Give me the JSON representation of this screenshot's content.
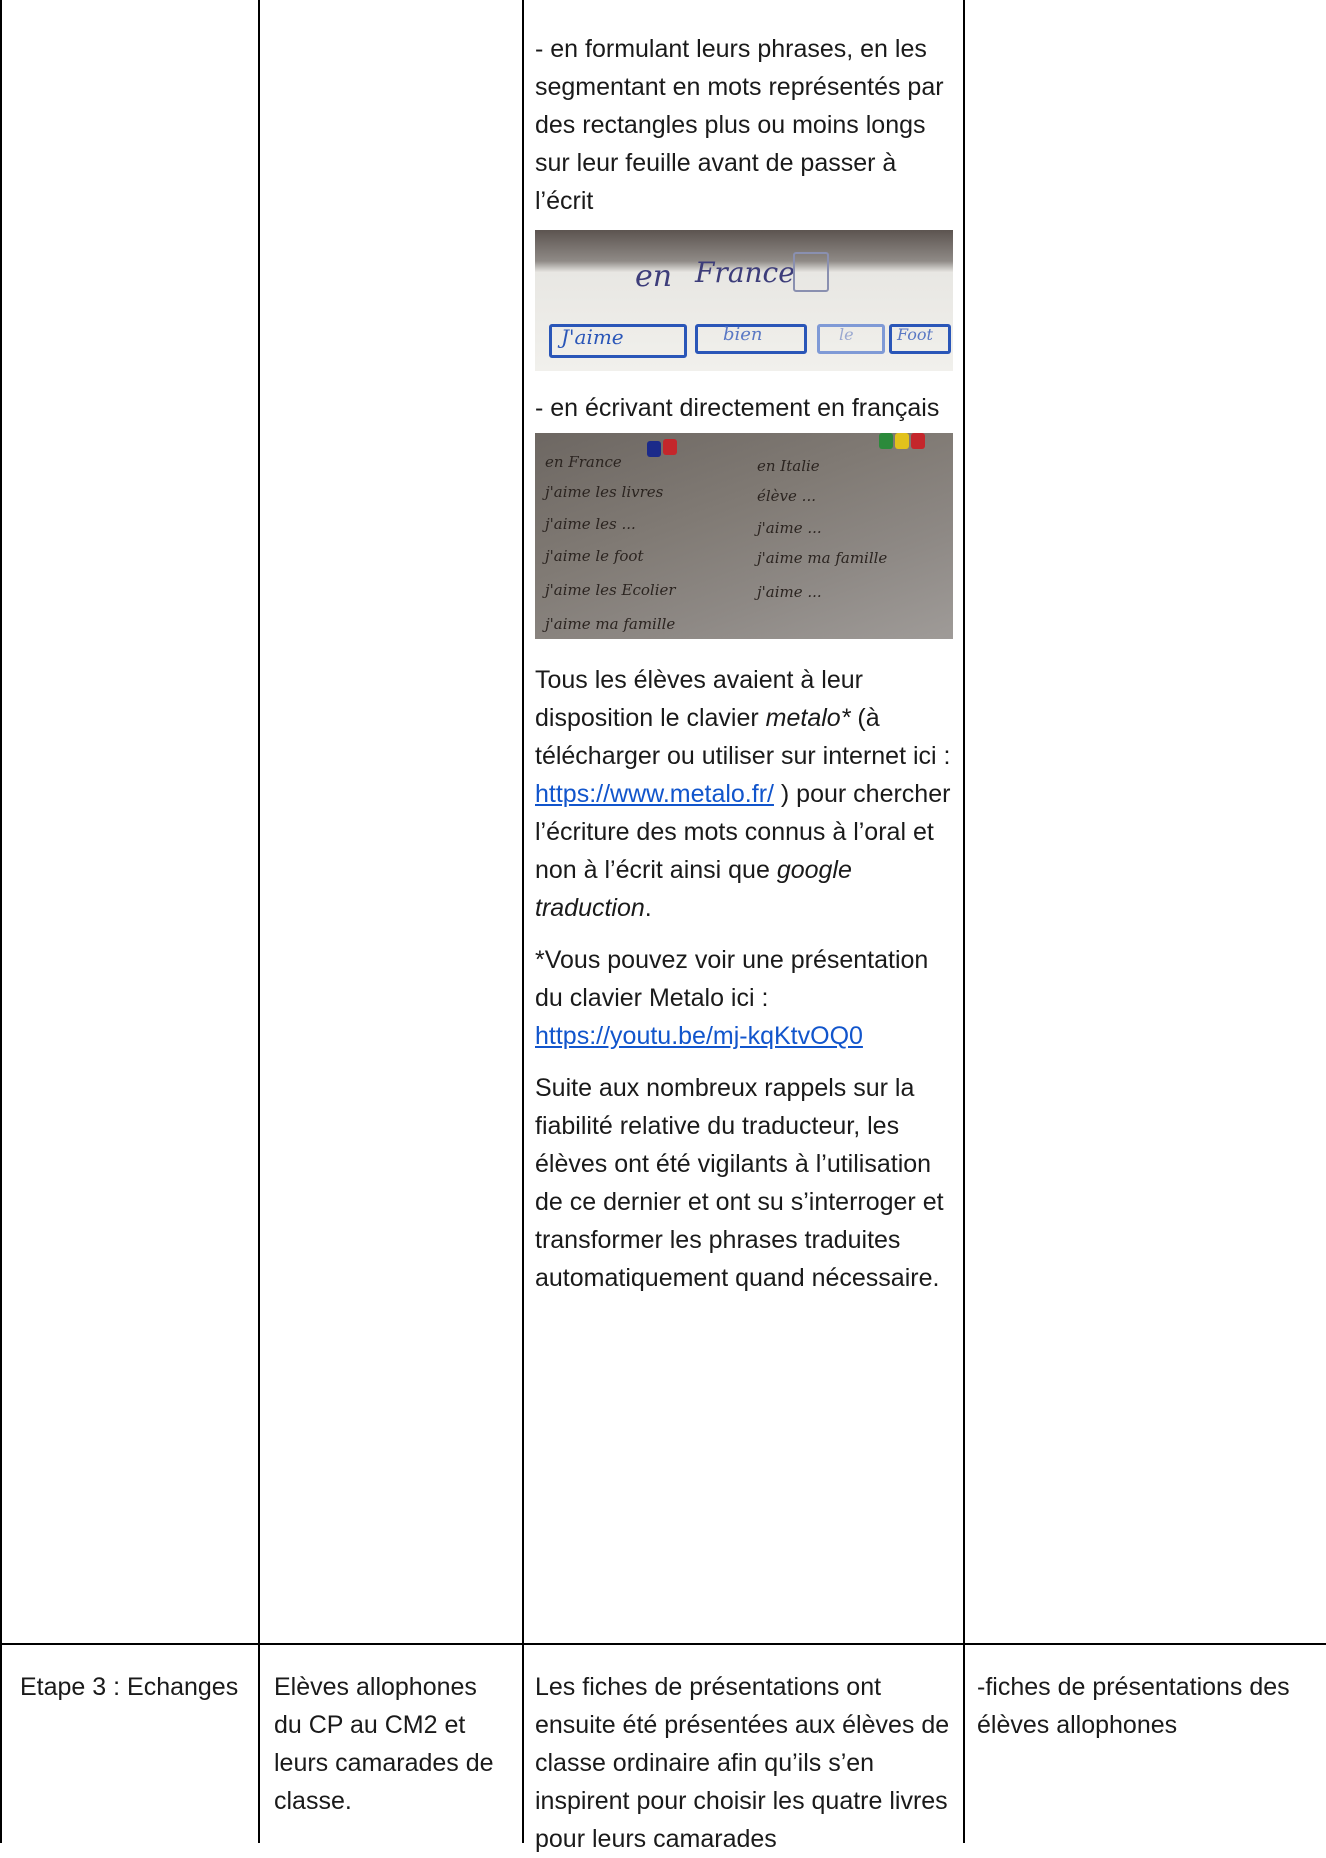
{
  "row1": {
    "col3": {
      "para1": "- en formulant leurs phrases, en les segmentant en mots représentés par des rectangles plus ou moins longs sur leur feuille avant de passer à l’écrit",
      "photo1": {
        "top_words": [
          "en",
          "France",
          "[ ]"
        ],
        "boxes": [
          "J'aime",
          "bien",
          "le",
          "Foot"
        ]
      },
      "para2": "- en écrivant directement en français",
      "photo2": {
        "left_lines": [
          "en France",
          "j'aime les livres",
          "j'aime les ...",
          "j'aime le foot",
          "j'aime les Ecolier",
          "j'aime ma famille"
        ],
        "right_lines": [
          "en Italie",
          "élève ...",
          "j'aime ...",
          "j'aime ma famille",
          "j'aime ..."
        ]
      },
      "para3": {
        "t1": "Tous les élèves avaient à leur disposition le clavier ",
        "em1": "metalo*",
        "t2": " (à télécharger ou utiliser sur internet ici : ",
        "link": "https://www.metalo.fr/",
        "t3": " ) pour chercher l’écriture des mots connus à l’oral et non à l’écrit ainsi que ",
        "em2": "google traduction",
        "t4": "."
      },
      "para4": {
        "t1": "*Vous pouvez voir une présentation du clavier Metalo ici : ",
        "link": "https://youtu.be/mj-kqKtvOQ0"
      },
      "para5": "Suite aux nombreux rappels sur la fiabilité relative du traducteur, les élèves ont été vigilants à l’utilisation de ce dernier et ont su s’interroger et transformer les phrases traduites automatiquement quand nécessaire."
    }
  },
  "row2": {
    "col1": "Etape 3 : Echanges",
    "col2": "Elèves allophones du CP au CM2 et leurs camarades de classe.",
    "col3": "Les fiches de présentations ont ensuite été présentées aux élèves de classe ordinaire afin qu’ils s’en inspirent pour choisir les quatre livres pour leurs camarades",
    "col4": "-fiches de présentations des élèves allophones"
  },
  "colors": {
    "link": "#1155cc",
    "border": "#000000",
    "box_ink": "#2a56b8"
  }
}
